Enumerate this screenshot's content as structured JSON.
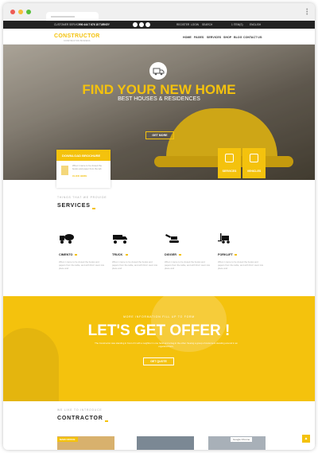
{
  "topbar": {
    "customer_service_label": "CUSTOMER SERVICE",
    "phone": "+90 444 7 676 15 TURKEY",
    "links": [
      "REGISTER",
      "LOGIN",
      "SEARCH"
    ],
    "cart": "1 ITEM(S)",
    "language": "ENGLISH"
  },
  "header": {
    "logo": "CONSTRUCTOR",
    "logo_sub": "CONSTRUCTION BUSINESS",
    "nav": [
      "HOME",
      "PAGES",
      "SERVICES",
      "SHOP",
      "BLOG",
      "CONTACT US"
    ]
  },
  "hero": {
    "title": "FIND YOUR NEW HOME",
    "subtitle": "BEST HOUSES & RESIDENCES",
    "button": "GET MORE"
  },
  "brochure": {
    "title": "DOWNLOAD BROCHURE",
    "text": "When I came to he closed the books and paper from the tab",
    "link": "CLICK HERE"
  },
  "features": [
    {
      "label": "SERVICES",
      "icon": "document-icon"
    },
    {
      "label": "VEHICLES",
      "icon": "truck-icon"
    }
  ],
  "services": {
    "small": "THINGS THAT WE PROVIDE",
    "title": "SERVICES",
    "items": [
      {
        "name": "CIMENTO",
        "icon": "cement-mixer-icon",
        "text": "When I came to he closed the books and papers from the table, and with first I went into place and"
      },
      {
        "name": "TRUCK",
        "icon": "dump-truck-icon",
        "text": "When I came to he closed the books and papers from the table, and with first I went into place and"
      },
      {
        "name": "DIGGER",
        "icon": "excavator-icon",
        "text": "When I came to he closed the books and papers from the table, and with first I went into place and"
      },
      {
        "name": "FORKLIFT",
        "icon": "forklift-icon",
        "text": "When I came to he closed the books and papers from the table, and with first I went into place and"
      }
    ]
  },
  "offer": {
    "small": "MORE INFORMATION FILL UP TO FORM",
    "title": "LET'S GET OFFER !",
    "text": "The Constructor was standing in front of it with a neighbor in one hand and a bag in the other. Seeing a group of customers standing around in an organized form,",
    "button": "GET QUOTE"
  },
  "contractor": {
    "small": "WE LIKE TO INTRODUCE",
    "title": "CONTRACTOR",
    "card1_label": "MAIN OFFICE",
    "card3_label": "Google Chrome"
  }
}
